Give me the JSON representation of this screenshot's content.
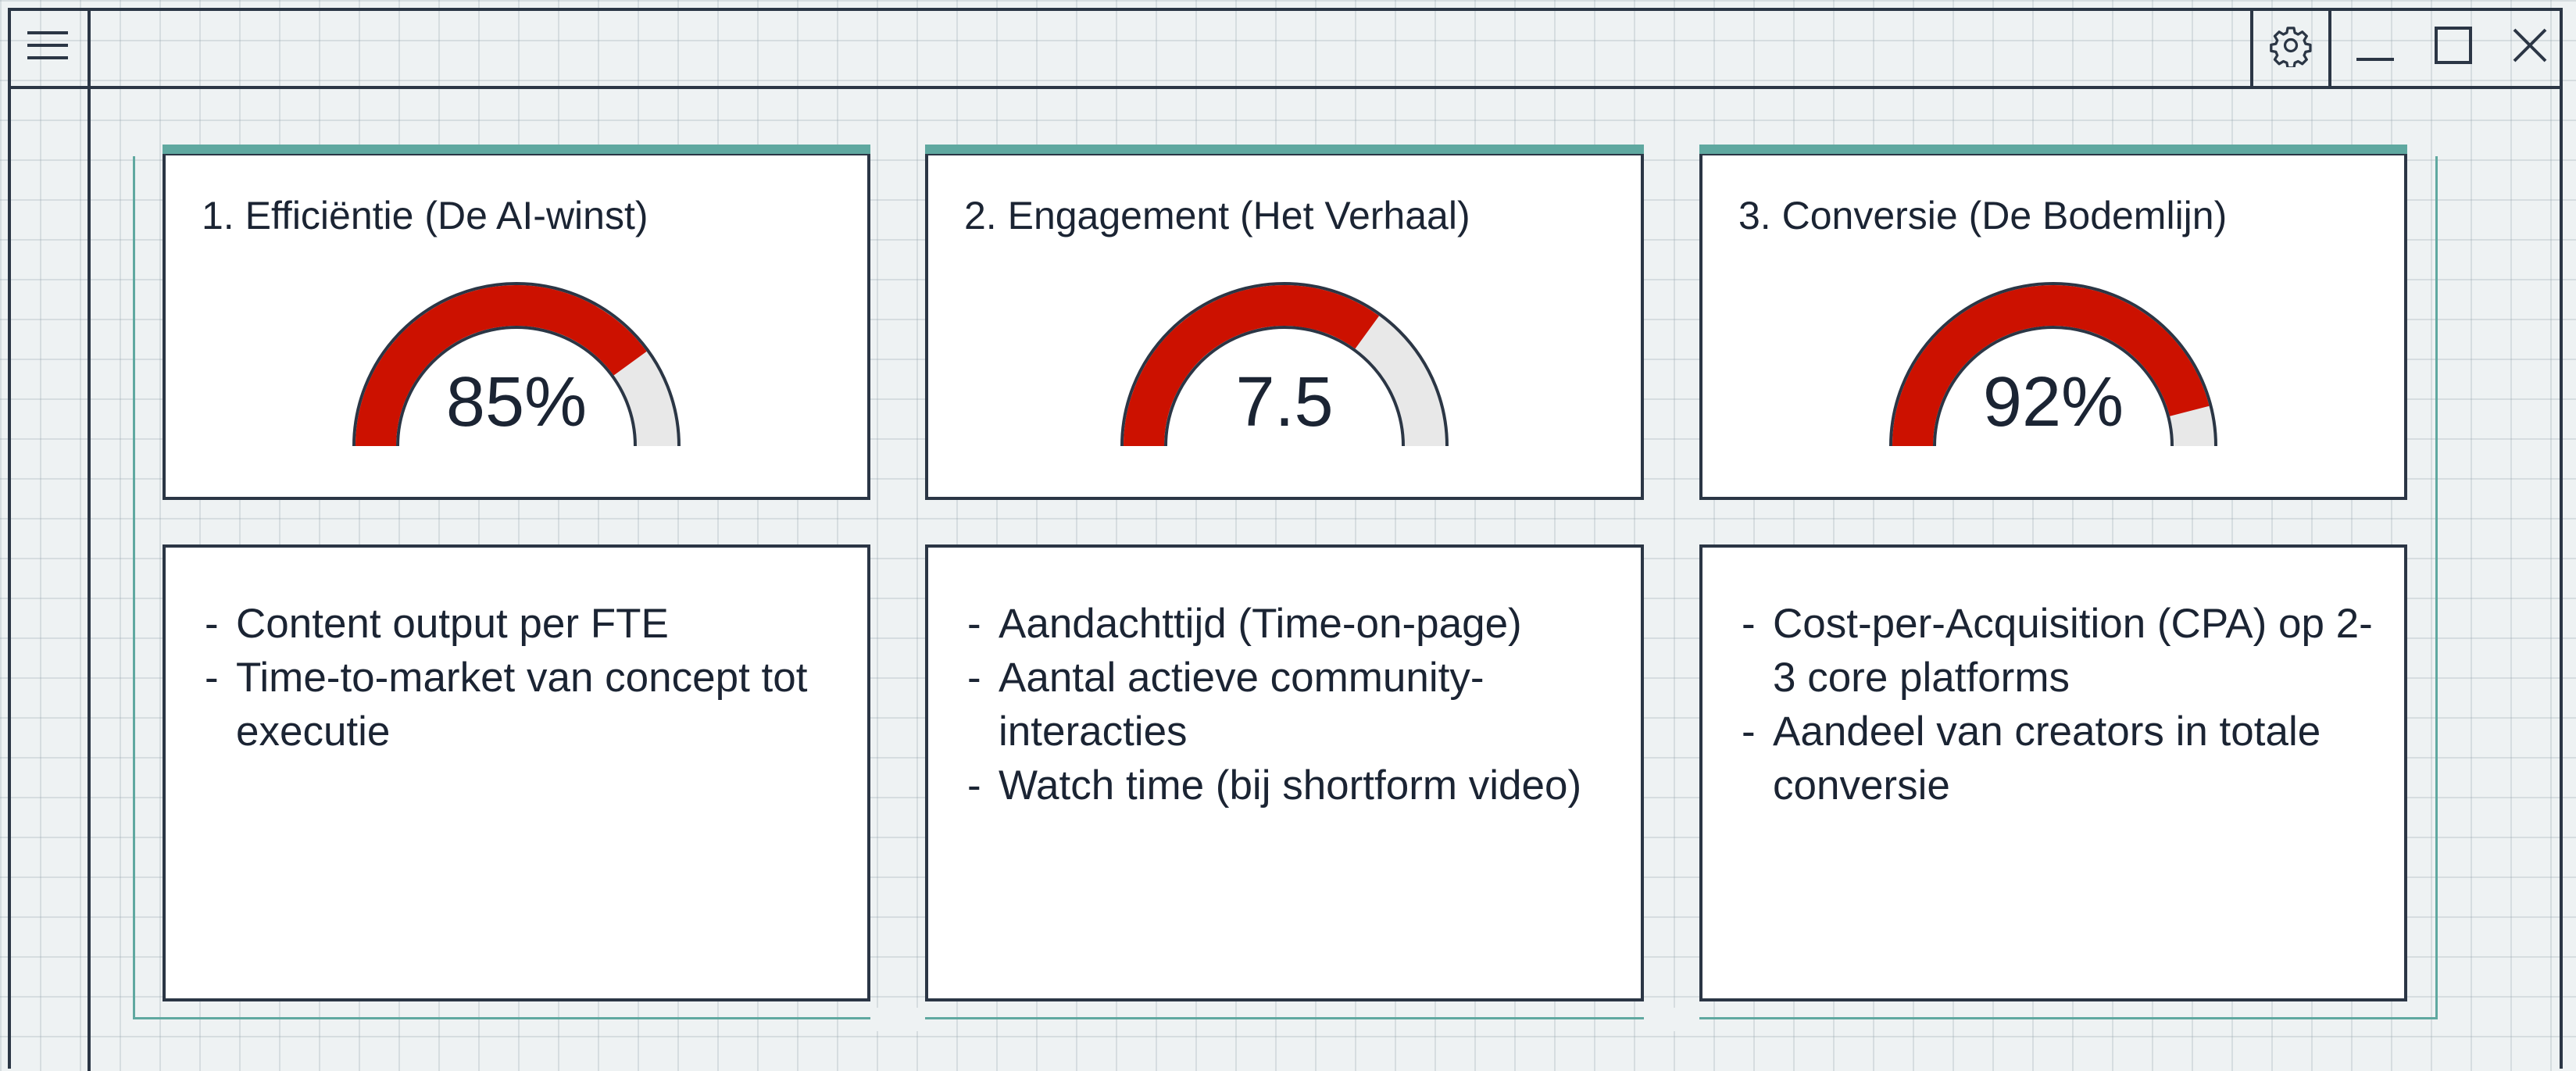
{
  "window": {
    "menu_icon": "hamburger-menu-icon",
    "controls": [
      "gear-icon",
      "minimize-icon",
      "maximize-icon",
      "close-icon"
    ]
  },
  "colors": {
    "accent": "#5fa8a0",
    "gauge_fill": "#cc1100",
    "gauge_track": "#e8e8e8",
    "border": "#2b3645"
  },
  "cards": [
    {
      "title": "1. Efficiëntie (De AI-winst)",
      "gauge_value": "85%",
      "gauge_fraction": 0.8,
      "bullets": [
        "Content output per FTE",
        "Time-to-market van concept tot executie"
      ]
    },
    {
      "title": "2. Engagement (Het Verhaal)",
      "gauge_value": "7.5",
      "gauge_fraction": 0.7,
      "bullets": [
        "Aandachttijd (Time-on-page)",
        "Aantal actieve community-interacties",
        "Watch time (bij shortform video)"
      ]
    },
    {
      "title": "3. Conversie (De Bodemlijn)",
      "gauge_value": "92%",
      "gauge_fraction": 0.92,
      "bullets": [
        "Cost-per-Acquisition (CPA) op 2-3 core platforms",
        "Aandeel van creators in totale conversie"
      ]
    }
  ]
}
